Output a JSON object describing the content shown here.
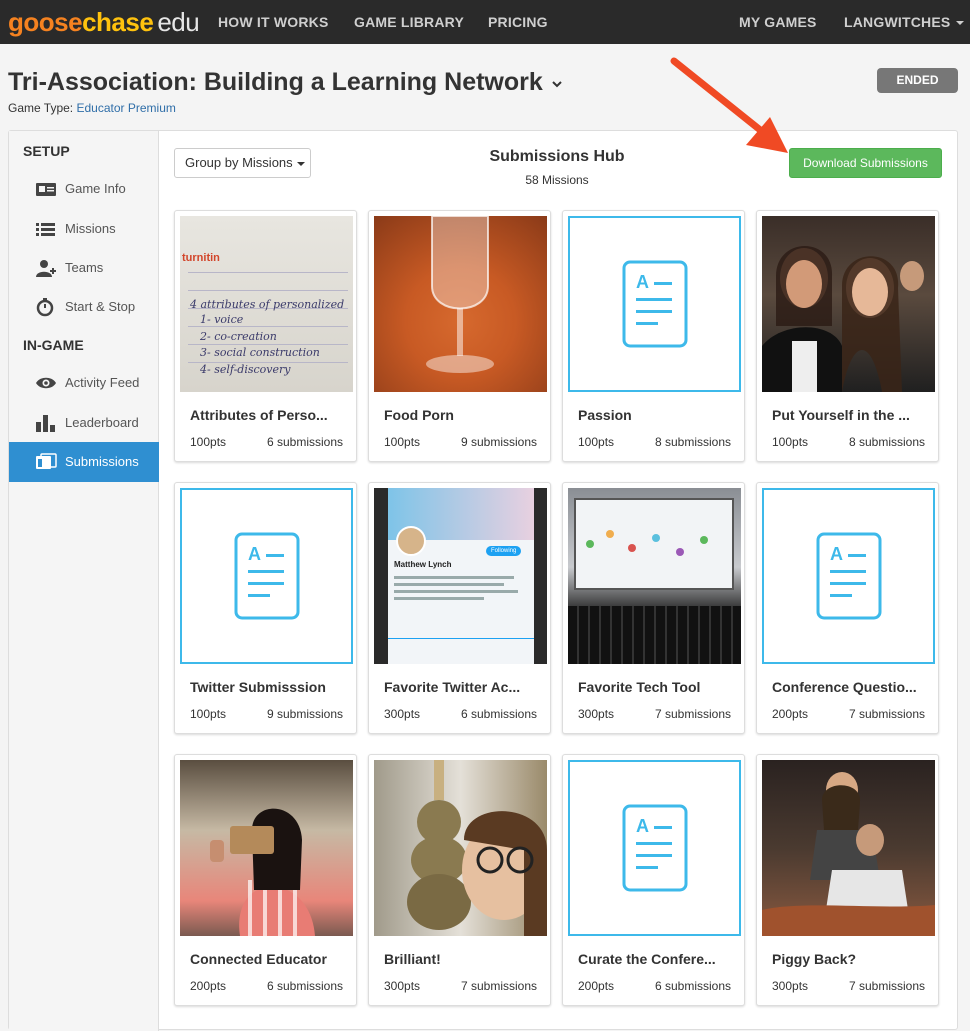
{
  "brand": {
    "goose": "goose",
    "chase": "chase",
    "edu": "edu"
  },
  "nav": {
    "how_it_works": "HOW IT WORKS",
    "game_library": "GAME LIBRARY",
    "pricing": "PRICING",
    "my_games": "MY GAMES",
    "account": "LANGWITCHES"
  },
  "header": {
    "title": "Tri-Association: Building a Learning Network",
    "game_type_label": "Game Type:",
    "game_type_value": "Educator Premium",
    "status": "ENDED"
  },
  "sidebar": {
    "setup_heading": "SETUP",
    "ingame_heading": "IN-GAME",
    "items": [
      {
        "label": "Game Info",
        "icon": "id-card-icon"
      },
      {
        "label": "Missions",
        "icon": "list-icon"
      },
      {
        "label": "Teams",
        "icon": "add-user-icon"
      },
      {
        "label": "Start & Stop",
        "icon": "stopwatch-icon"
      },
      {
        "label": "Activity Feed",
        "icon": "eye-icon"
      },
      {
        "label": "Leaderboard",
        "icon": "bar-chart-icon"
      },
      {
        "label": "Submissions",
        "icon": "photos-icon"
      }
    ]
  },
  "hub": {
    "group_label": "Group by Missions",
    "title": "Submissions Hub",
    "subtitle": "58 Missions",
    "download_label": "Download Submissions"
  },
  "handwriting": [
    "4 attributes of personalized",
    "1- voice",
    "2- co-creation",
    "3- social construction",
    "4- self-discovery"
  ],
  "paper_brand": "turnitin",
  "missions": [
    {
      "name": "Attributes of Perso...",
      "points": "100pts",
      "submissions": "6 submissions",
      "thumb": "photo"
    },
    {
      "name": "Food Porn",
      "points": "100pts",
      "submissions": "9 submissions",
      "thumb": "photo"
    },
    {
      "name": "Passion",
      "points": "100pts",
      "submissions": "8 submissions",
      "thumb": "text"
    },
    {
      "name": "Put Yourself in the ...",
      "points": "100pts",
      "submissions": "8 submissions",
      "thumb": "photo"
    },
    {
      "name": "Twitter Submisssion",
      "points": "100pts",
      "submissions": "9 submissions",
      "thumb": "text"
    },
    {
      "name": "Favorite Twitter Ac...",
      "points": "300pts",
      "submissions": "6 submissions",
      "thumb": "photo"
    },
    {
      "name": "Favorite Tech Tool",
      "points": "300pts",
      "submissions": "7 submissions",
      "thumb": "photo"
    },
    {
      "name": "Conference Questio...",
      "points": "200pts",
      "submissions": "7 submissions",
      "thumb": "text"
    },
    {
      "name": "Connected Educator",
      "points": "200pts",
      "submissions": "6 submissions",
      "thumb": "photo"
    },
    {
      "name": "Brilliant!",
      "points": "300pts",
      "submissions": "7 submissions",
      "thumb": "photo"
    },
    {
      "name": "Curate the Confere...",
      "points": "200pts",
      "submissions": "6 submissions",
      "thumb": "text"
    },
    {
      "name": "Piggy Back?",
      "points": "300pts",
      "submissions": "7 submissions",
      "thumb": "photo"
    }
  ],
  "phone_profile": {
    "name": "Matthew Lynch",
    "following_btn": "Following"
  },
  "colors": {
    "nav_bg": "#2a2a2a",
    "brand_orange": "#f58220",
    "brand_yellow": "#ffc20e",
    "active_blue": "#2f8fd1",
    "download_green": "#5cb85c",
    "text_thumb_blue": "#3db9ea",
    "ended_gray": "#777777",
    "annotation_arrow": "#f04a24"
  }
}
